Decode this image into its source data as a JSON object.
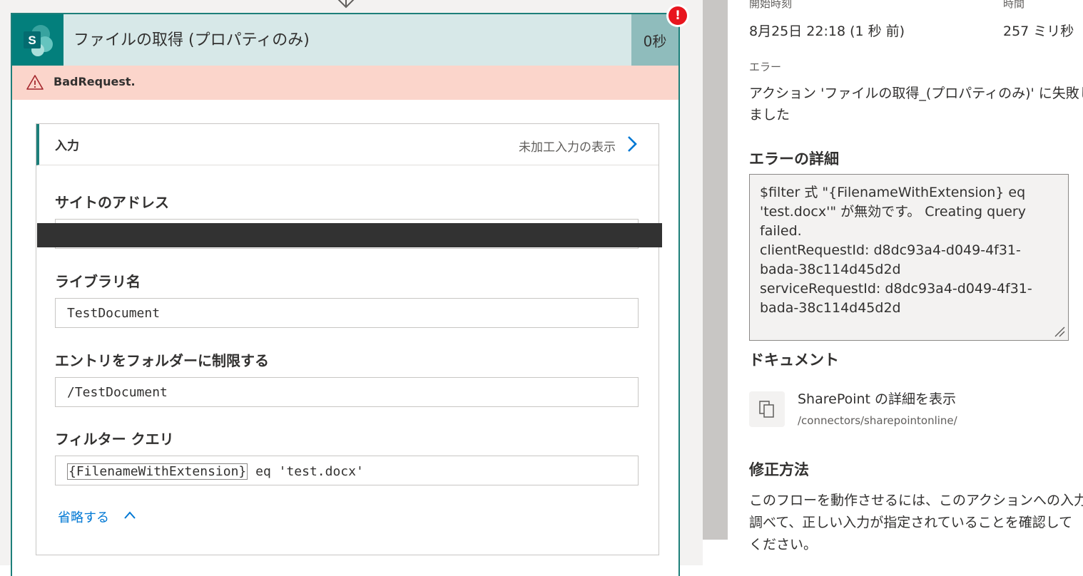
{
  "card": {
    "title": "ファイルの取得 (プロパティのみ)",
    "duration": "0秒",
    "error_badge": "!",
    "error_banner": "BadRequest."
  },
  "inputs": {
    "title": "入力",
    "raw_link": "未加工入力の表示",
    "collapse_label": "省略する"
  },
  "fields": {
    "site_address": {
      "label": "サイトのアドレス",
      "value": ""
    },
    "library_name": {
      "label": "ライブラリ名",
      "value": "TestDocument"
    },
    "limit_folder": {
      "label": "エントリをフォルダーに制限する",
      "value": "/TestDocument"
    },
    "filter_query": {
      "label": "フィルター クエリ",
      "token_open": "{",
      "token_name": "FilenameWithExtension",
      "token_close": "}",
      "value_rest": " eq 'test.docx'"
    }
  },
  "details": {
    "start_time_label": "開始時刻",
    "start_time_value": "8月25日 22:18 (1 秒 前)",
    "duration_label": "時間",
    "duration_value": "257 ミリ秒",
    "error_label": "エラー",
    "error_message_lines": [
      "アクション 'ファイルの取得_(プロパティのみ)' に失敗し",
      "ました"
    ],
    "error_details_heading": "エラーの詳細",
    "error_details_lines": [
      "$filter 式 \"{FilenameWithExtension} eq",
      "'test.docx'\" が無効です。 Creating query",
      "failed.",
      "clientRequestId: d8dc93a4-d049-4f31-",
      "bada-38c114d45d2d",
      "serviceRequestId: d8dc93a4-d049-4f31-",
      "bada-38c114d45d2d"
    ],
    "documents_heading": "ドキュメント",
    "doc_link_title": "SharePoint の詳細を表示",
    "doc_link_path": "/connectors/sharepointonline/",
    "fix_heading": "修正方法",
    "fix_lines": [
      "このフローを動作させるには、このアクションへの入力を",
      "調べて、正しい入力が指定されていることを確認して",
      "ください。"
    ]
  },
  "colors": {
    "brand_teal": "#037f7c",
    "header_bg": "#d7e8e8",
    "error_red": "#e8151e",
    "error_banner_bg": "#fbd5cb",
    "link_blue": "#0078d4"
  },
  "icons": {
    "logo": "sharepoint-logo-icon",
    "warning": "warning-triangle-icon",
    "chevron_right": "chevron-right-icon",
    "chevron_up": "chevron-up-icon",
    "document": "copy-document-icon",
    "flow_arrow": "arrow-down-icon"
  }
}
